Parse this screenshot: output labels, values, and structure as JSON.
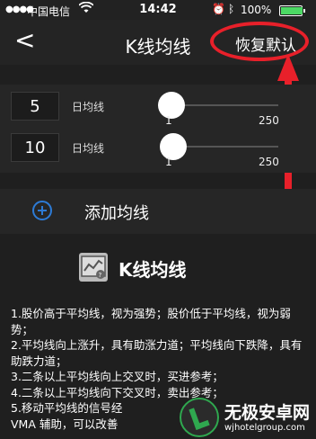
{
  "status_bar": {
    "carrier": "中国电信",
    "time": "14:42",
    "battery": "100%",
    "battery_level": 1.0
  },
  "nav": {
    "back": "<",
    "title": "K线均线",
    "reset": "恢复默认"
  },
  "ma_rows": [
    {
      "period": "5",
      "label": "日均线",
      "min": "1",
      "max": "250",
      "value": 5
    },
    {
      "period": "10",
      "label": "日均线",
      "min": "1",
      "max": "250",
      "value": 10
    }
  ],
  "add": {
    "label": "添加均线"
  },
  "info": {
    "title": "K线均线",
    "lines": [
      "1.股价高于平均线，视为强势；股价低于平均线，视为弱势；",
      "2.平均线向上涨升，具有助涨力道；平均线向下跌降，具有助跌力道；",
      "3.二条以上平均线向上交叉时，买进参考；",
      "4.二条以上平均线向下交叉时，卖出参考；",
      "5.移动平均线的信号经",
      "VMA 辅助，可以改善"
    ]
  },
  "watermark": {
    "title": "无极安卓网",
    "url": "wjhotelgroup.com"
  },
  "colors": {
    "accent": "#2d7bd6",
    "highlight": "#e8202a",
    "background": "#1f1f1f"
  }
}
